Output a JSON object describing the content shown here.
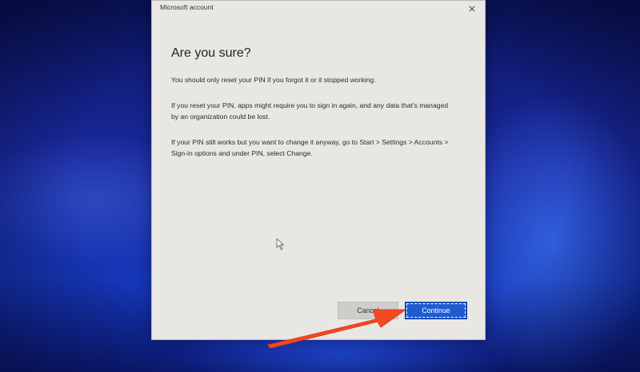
{
  "window": {
    "title": "Microsoft account",
    "close_label": "close"
  },
  "dialog": {
    "heading": "Are you sure?",
    "paragraphs": [
      "You should only reset your PIN if you forgot it or it stopped working.",
      "If you reset your PIN, apps might require you to sign in again, and any data that's managed by an organization could be lost.",
      "If your PIN still works but you want to change it anyway, go to Start > Settings > Accounts > Sign-in options and under PIN, select Change."
    ]
  },
  "buttons": {
    "cancel_label": "Cancel",
    "continue_label": "Continue"
  },
  "annotation": {
    "arrow_color": "#f04a25",
    "points_to": "continue-button"
  },
  "colors": {
    "accent": "#1f5cd0",
    "dialog_background": "#e9e7e3"
  }
}
